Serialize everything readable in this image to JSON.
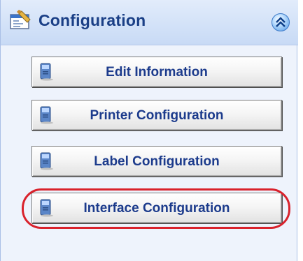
{
  "panel": {
    "title": "Configuration",
    "icon": "settings-window-icon",
    "collapse_icon": "double-chevron-up-icon"
  },
  "buttons": [
    {
      "label": "Edit Information",
      "icon": "computer-icon"
    },
    {
      "label": "Printer Configuration",
      "icon": "computer-icon"
    },
    {
      "label": "Label Configuration",
      "icon": "computer-icon"
    },
    {
      "label": "Interface Configuration",
      "icon": "computer-icon",
      "highlighted": true
    }
  ],
  "colors": {
    "title_text": "#1a3f86",
    "button_text": "#1c3b8c",
    "highlight": "#d9222c",
    "panel_bg": "#eef3fc"
  }
}
